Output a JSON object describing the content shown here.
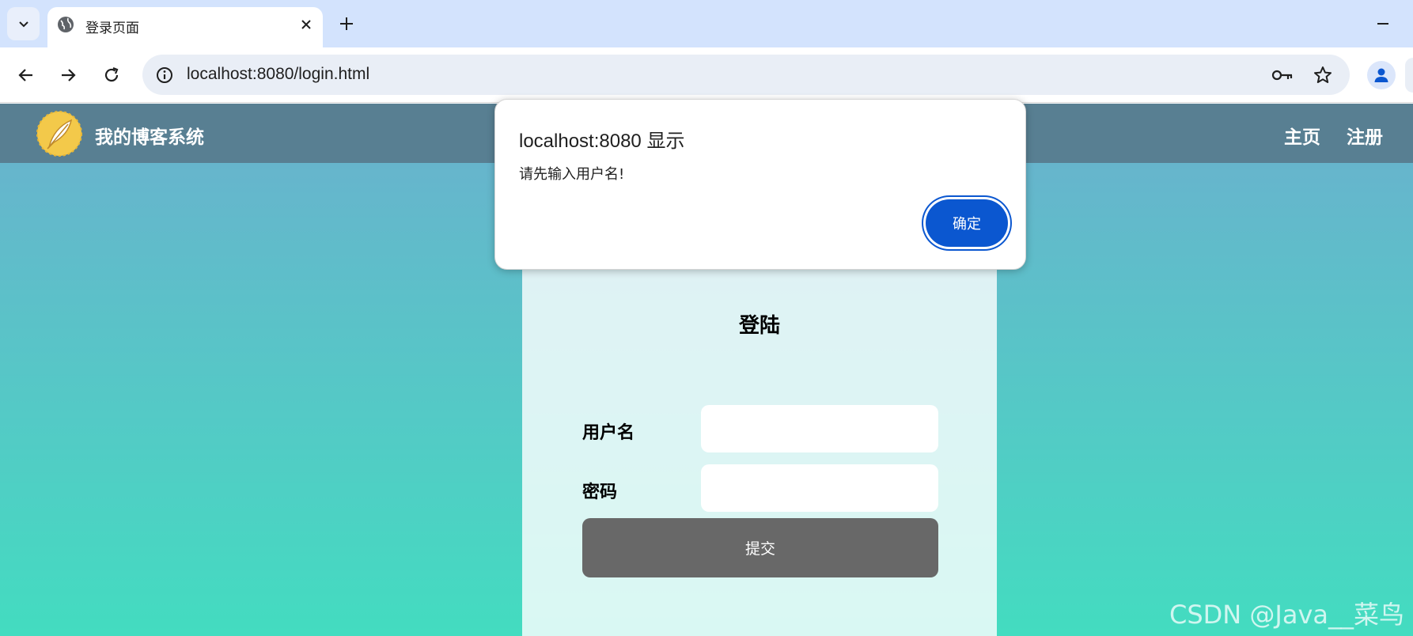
{
  "browser": {
    "tab_title": "登录页面",
    "url": "localhost:8080/login.html"
  },
  "site": {
    "title": "我的博客系统",
    "nav": [
      "主页",
      "注册"
    ]
  },
  "login": {
    "title": "登陆",
    "username_label": "用户名",
    "password_label": "密码",
    "submit_label": "提交"
  },
  "dialog": {
    "title": "localhost:8080 显示",
    "message": "请先输入用户名!",
    "ok_label": "确定"
  },
  "watermark": "CSDN @Java__菜鸟",
  "colors": {
    "nav_bg": "#587f92",
    "gradient_top": "#6bb0ce",
    "gradient_bottom": "#43dcc0",
    "submit_bg": "#686868",
    "dialog_button": "#0b57d0"
  }
}
